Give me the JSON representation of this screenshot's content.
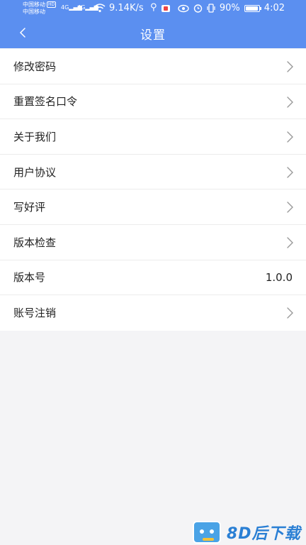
{
  "status_bar": {
    "carrier1": "中国移动",
    "carrier1_badge": "HD",
    "carrier2": "中国移动",
    "signal1": "4G",
    "signal2": "4G",
    "net_speed": "9.14K/s",
    "battery_percent": "90%",
    "time": "4:02"
  },
  "header": {
    "title": "设置",
    "back_icon": "chevron-left-icon"
  },
  "settings": {
    "items": [
      {
        "label": "修改密码",
        "icon": "chevron-right-icon"
      },
      {
        "label": "重置签名口令",
        "icon": "chevron-right-icon"
      },
      {
        "label": "关于我们",
        "icon": "chevron-right-icon"
      },
      {
        "label": "用户协议",
        "icon": "chevron-right-icon"
      },
      {
        "label": "写好评",
        "icon": "chevron-right-icon"
      },
      {
        "label": "版本检查",
        "icon": "chevron-right-icon"
      },
      {
        "label": "版本号",
        "value": "1.0.0"
      },
      {
        "label": "账号注销",
        "icon": "chevron-right-icon"
      }
    ]
  },
  "watermark": {
    "text": "8D后下载"
  },
  "colors": {
    "header_bg": "#5b8ff0",
    "page_bg": "#f4f4f6",
    "row_bg": "#ffffff",
    "text": "#222222",
    "chevron": "#999999"
  }
}
